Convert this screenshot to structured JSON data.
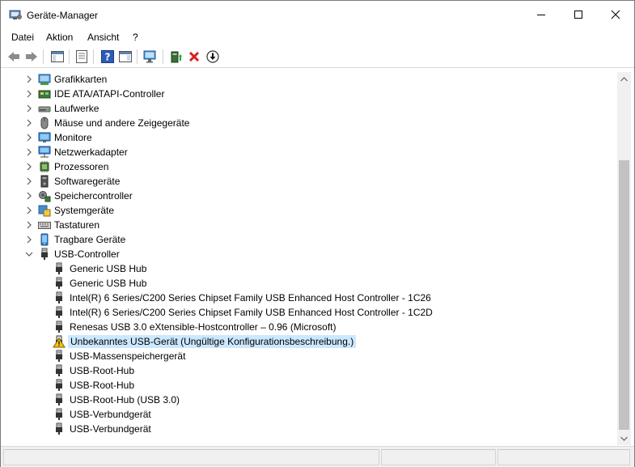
{
  "window": {
    "title": "Geräte-Manager"
  },
  "menu": [
    "Datei",
    "Aktion",
    "Ansicht",
    "?"
  ],
  "toolbar": {
    "buttons": [
      "back-icon",
      "forward-icon",
      "properties-view-icon",
      "list-view-icon",
      "help-icon",
      "details-view-icon",
      "monitor-scan-icon",
      "update-driver-icon",
      "uninstall-icon",
      "download-icon"
    ]
  },
  "tree": {
    "categories": [
      {
        "label": "Grafikkarten",
        "icon": "display-adapter-icon"
      },
      {
        "label": "IDE ATA/ATAPI-Controller",
        "icon": "ide-controller-icon"
      },
      {
        "label": "Laufwerke",
        "icon": "disk-drive-icon"
      },
      {
        "label": "Mäuse und andere Zeigegeräte",
        "icon": "mouse-icon"
      },
      {
        "label": "Monitore",
        "icon": "monitor-icon"
      },
      {
        "label": "Netzwerkadapter",
        "icon": "network-adapter-icon"
      },
      {
        "label": "Prozessoren",
        "icon": "processor-icon"
      },
      {
        "label": "Softwaregeräte",
        "icon": "software-device-icon"
      },
      {
        "label": "Speichercontroller",
        "icon": "storage-controller-icon"
      },
      {
        "label": "Systemgeräte",
        "icon": "system-device-icon"
      },
      {
        "label": "Tastaturen",
        "icon": "keyboard-icon"
      },
      {
        "label": "Tragbare Geräte",
        "icon": "portable-device-icon"
      },
      {
        "label": "USB-Controller",
        "icon": "usb-icon"
      }
    ],
    "usb_children": [
      {
        "label": "Generic USB Hub",
        "icon": "usb-plug-icon"
      },
      {
        "label": "Generic USB Hub",
        "icon": "usb-plug-icon"
      },
      {
        "label": "Intel(R) 6 Series/C200 Series Chipset Family USB Enhanced Host Controller - 1C26",
        "icon": "usb-plug-icon"
      },
      {
        "label": "Intel(R) 6 Series/C200 Series Chipset Family USB Enhanced Host Controller - 1C2D",
        "icon": "usb-plug-icon"
      },
      {
        "label": "Renesas USB 3.0 eXtensible-Hostcontroller – 0.96 (Microsoft)",
        "icon": "usb-plug-icon"
      },
      {
        "label": "Unbekanntes USB-Gerät (Ungültige Konfigurationsbeschreibung.)",
        "icon": "warning-icon",
        "selected": true
      },
      {
        "label": "USB-Massenspeichergerät",
        "icon": "usb-plug-icon"
      },
      {
        "label": "USB-Root-Hub",
        "icon": "usb-plug-icon"
      },
      {
        "label": "USB-Root-Hub",
        "icon": "usb-plug-icon"
      },
      {
        "label": "USB-Root-Hub (USB 3.0)",
        "icon": "usb-plug-icon"
      },
      {
        "label": "USB-Verbundgerät",
        "icon": "usb-plug-icon"
      },
      {
        "label": "USB-Verbundgerät",
        "icon": "usb-plug-icon"
      }
    ]
  }
}
